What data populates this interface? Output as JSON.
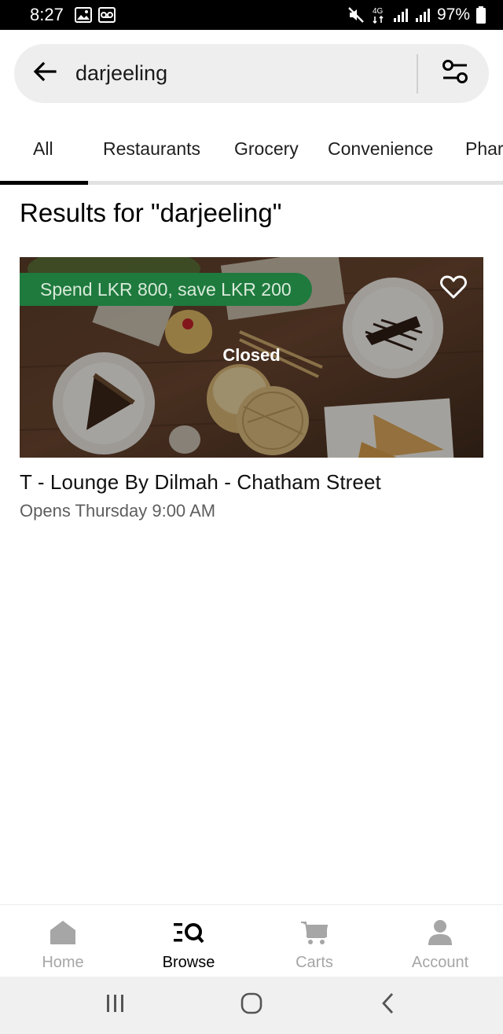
{
  "status_bar": {
    "time": "8:27",
    "network": "4G",
    "battery": "97%"
  },
  "search": {
    "query": "darjeeling"
  },
  "tabs": [
    {
      "label": "All",
      "active": true
    },
    {
      "label": "Restaurants",
      "active": false
    },
    {
      "label": "Grocery",
      "active": false
    },
    {
      "label": "Convenience",
      "active": false
    },
    {
      "label": "Phar",
      "active": false
    }
  ],
  "results": {
    "title": "Results for \"darjeeling\"",
    "stores": [
      {
        "promo": "Spend LKR 800, save LKR 200",
        "overlay_status": "Closed",
        "name": "T - Lounge By Dilmah - Chatham Street",
        "hours": "Opens Thursday 9:00 AM",
        "favorited": false
      }
    ]
  },
  "bottom_nav": [
    {
      "label": "Home",
      "icon": "home-icon",
      "active": false
    },
    {
      "label": "Browse",
      "icon": "browse-search-icon",
      "active": true
    },
    {
      "label": "Carts",
      "icon": "cart-icon",
      "active": false
    },
    {
      "label": "Account",
      "icon": "account-icon",
      "active": false
    }
  ],
  "colors": {
    "promo_green": "#1f7a3e",
    "active_tab": "#000000",
    "inactive_nav": "#a6a6a6",
    "search_bg": "#eeeeee"
  }
}
